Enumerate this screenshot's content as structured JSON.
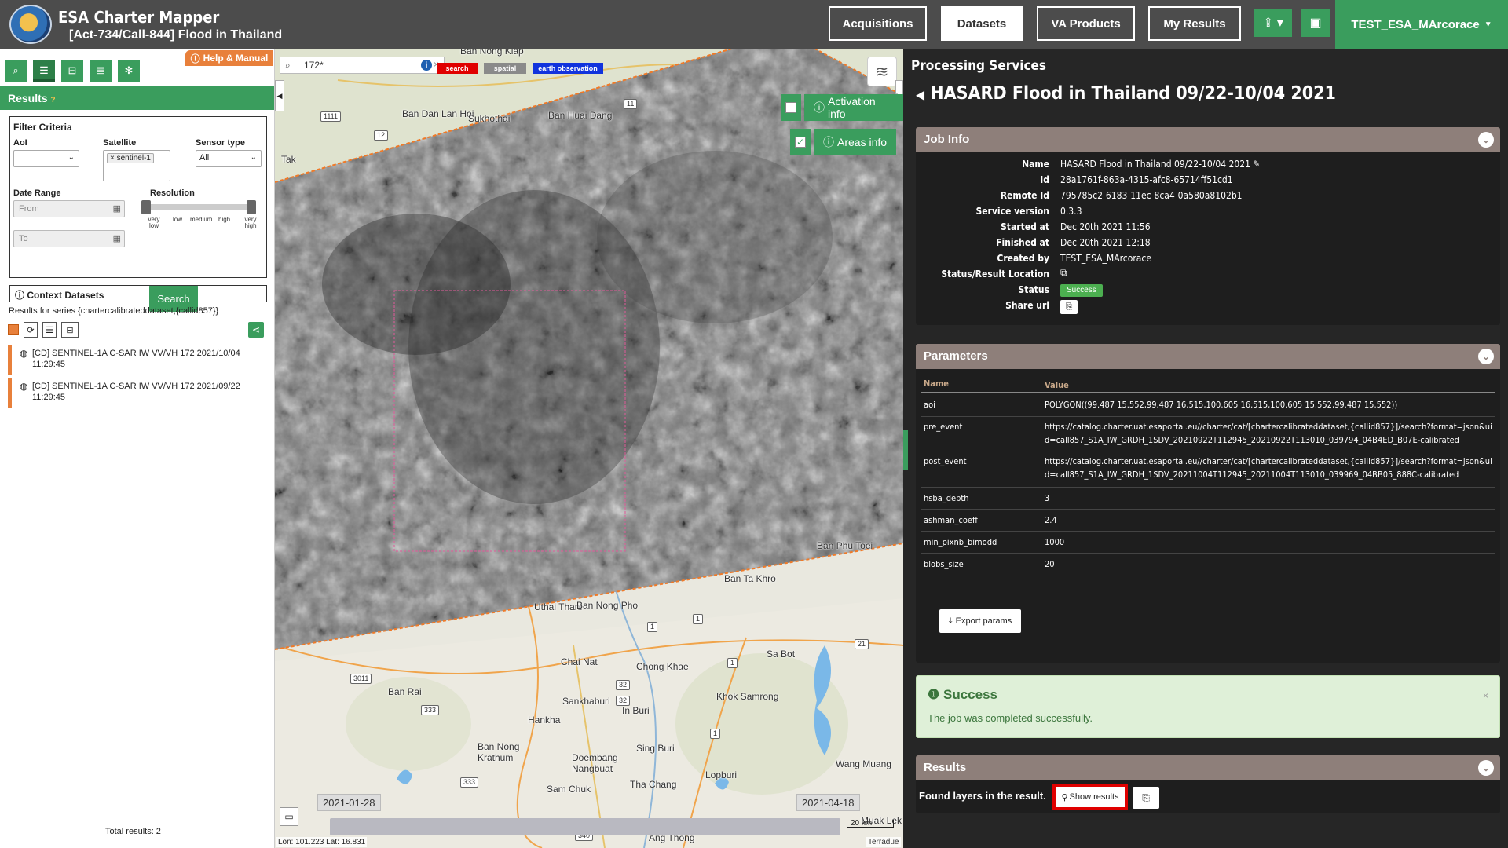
{
  "header": {
    "app_title": "ESA Charter Mapper",
    "activation": "[Act-734/Call-844] Flood in Thailand",
    "nav": [
      "Acquisitions",
      "Datasets",
      "VA Products",
      "My Results"
    ],
    "active_nav": "Datasets",
    "user": "TEST_ESA_MArcorace"
  },
  "left": {
    "help_label": "Help & Manual",
    "results_label": "Results",
    "filter": {
      "title": "Filter Criteria",
      "aoi_label": "AoI",
      "satellite_label": "Satellite",
      "satellite_chip": "sentinel-1",
      "sensor_label": "Sensor type",
      "sensor_value": "All",
      "date_label": "Date Range",
      "from_placeholder": "From",
      "to_placeholder": "To",
      "resolution_label": "Resolution",
      "resolution_ticks": [
        "very low",
        "low",
        "medium",
        "high",
        "very high"
      ],
      "search_label": "Search"
    },
    "context_label": "Context Datasets",
    "series_text": "Results for series {chartercalibrateddataset,{callid857}}",
    "datasets": [
      "[CD] SENTINEL-1A C-SAR IW VV/VH 172 2021/10/04 11:29:45",
      "[CD] SENTINEL-1A C-SAR IW VV/VH 172 2021/09/22 11:29:45"
    ],
    "total_results": "Total results: 2"
  },
  "map": {
    "search_value": "172*",
    "tags": [
      "search",
      "spatial",
      "earth observation"
    ],
    "tag_colors": [
      "#e00000",
      "#8a8a8a",
      "#1133dd"
    ],
    "activation_info": "Activation info",
    "areas_info": "Areas info",
    "time_start": "2021-01-28",
    "time_end": "2021-04-18",
    "coords": "Lon: 101.223 Lat: 16.831",
    "scale": "20 km",
    "attribution": "Terradue",
    "towns": [
      "Ban Nong Klap",
      "Ban Dan Lan Hoi",
      "Sukhothai",
      "Ban Huai Dang",
      "Tak",
      "Ban Phu Toei",
      "Ban Ta Khro",
      "Uthai Thani",
      "Ban Nong Pho",
      "Chai Nat",
      "Chong Khae",
      "Sa Bot",
      "Ban Rai",
      "Sankhaburi",
      "In Buri",
      "Khok Samrong",
      "Hankha",
      "Ban Nong Krathum",
      "Doembang Nangbuat",
      "Sing Buri",
      "Sam Chuk",
      "Tha Chang",
      "Lopburi",
      "Wang Muang",
      "Ang Thong",
      "Muak Lek"
    ],
    "roads": [
      "1111",
      "12",
      "11",
      "1",
      "1",
      "1",
      "21",
      "3011",
      "32",
      "32",
      "1",
      "333",
      "333",
      "340"
    ]
  },
  "right": {
    "section_title": "Processing Services",
    "job_title": "HASARD Flood in Thailand 09/22-10/04 2021",
    "job_info": {
      "title": "Job Info",
      "rows": [
        {
          "k": "Name",
          "v": "HASARD Flood in Thailand 09/22-10/04 2021"
        },
        {
          "k": "Id",
          "v": "28a1761f-863a-4315-afc8-65714ff51cd1"
        },
        {
          "k": "Remote Id",
          "v": "795785c2-6183-11ec-8ca4-0a580a8102b1"
        },
        {
          "k": "Service version",
          "v": "0.3.3"
        },
        {
          "k": "Started at",
          "v": "Dec 20th 2021 11:56"
        },
        {
          "k": "Finished at",
          "v": "Dec 20th 2021 12:18"
        },
        {
          "k": "Created by",
          "v": "TEST_ESA_MArcorace"
        },
        {
          "k": "Status/Result Location",
          "v": ""
        },
        {
          "k": "Status",
          "v": ""
        },
        {
          "k": "Share url",
          "v": ""
        }
      ],
      "status": "Success"
    },
    "parameters": {
      "title": "Parameters",
      "col_name": "Name",
      "col_value": "Value",
      "rows": [
        {
          "n": "aoi",
          "v": "POLYGON((99.487 15.552,99.487 16.515,100.605 16.515,100.605 15.552,99.487 15.552))"
        },
        {
          "n": "pre_event",
          "v": "https://catalog.charter.uat.esaportal.eu//charter/cat/[chartercalibrateddataset,{callid857}]/search?format=json&uid=call857_S1A_IW_GRDH_1SDV_20210922T112945_20210922T113010_039794_04B4ED_B07E-calibrated"
        },
        {
          "n": "post_event",
          "v": "https://catalog.charter.uat.esaportal.eu//charter/cat/[chartercalibrateddataset,{callid857}]/search?format=json&uid=call857_S1A_IW_GRDH_1SDV_20211004T112945_20211004T113010_039969_04BB05_888C-calibrated"
        },
        {
          "n": "hsba_depth",
          "v": "3"
        },
        {
          "n": "ashman_coeff",
          "v": "2.4"
        },
        {
          "n": "min_pixnb_bimodd",
          "v": "1000"
        },
        {
          "n": "blobs_size",
          "v": "20"
        }
      ],
      "export_label": "Export params"
    },
    "success": {
      "title": "Success",
      "message": "The job was completed successfully."
    },
    "results": {
      "title": "Results",
      "found_text": "Found layers in the result.",
      "show_label": "Show results"
    }
  }
}
